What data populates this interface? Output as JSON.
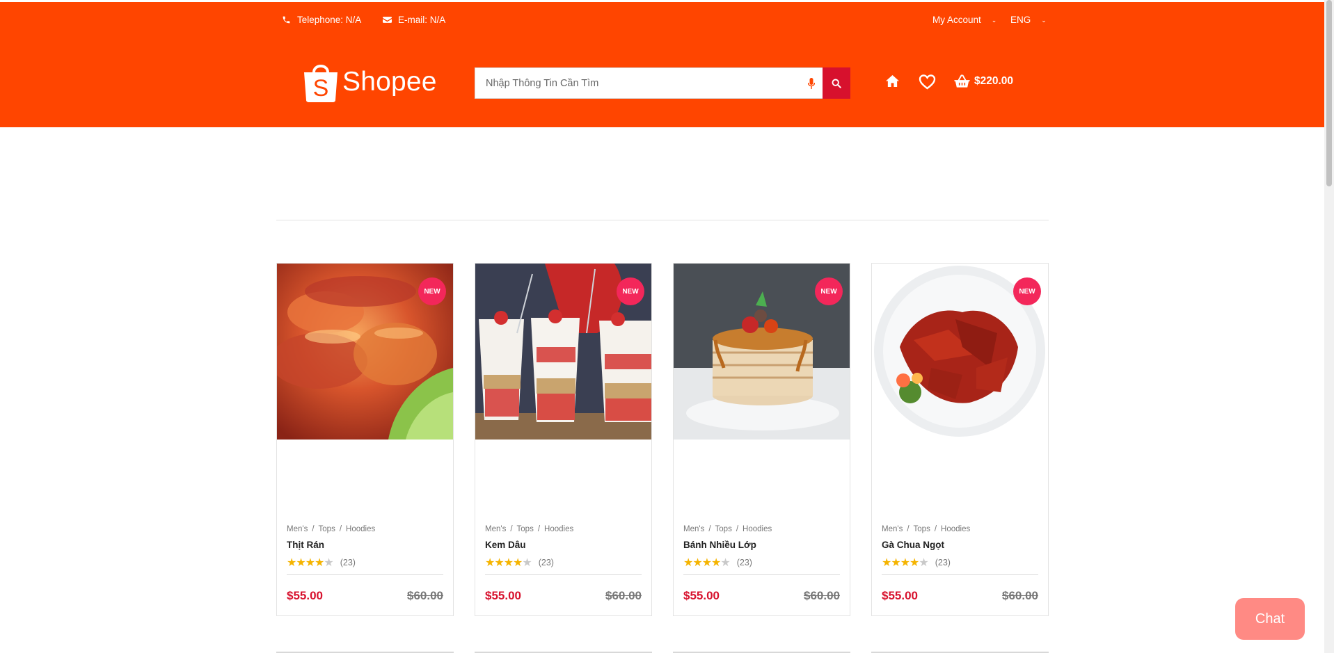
{
  "topbar": {
    "telephone": "Telephone: N/A",
    "email": "E-mail: N/A",
    "account": "My Account",
    "language": "ENG"
  },
  "logo": {
    "text": "Shopee",
    "icon": "shopping-bag-icon"
  },
  "search": {
    "placeholder": "Nhập Thông Tin Cần Tìm",
    "value": ""
  },
  "header_actions": {
    "cart_total": "$220.00"
  },
  "products": [
    {
      "badge": "NEW",
      "crumbs": [
        "Men's",
        "Tops",
        "Hoodies"
      ],
      "name": "Thịt Rán",
      "rating": 4.5,
      "reviews": "(23)",
      "price": "$55.00",
      "old_price": "$60.00"
    },
    {
      "badge": "NEW",
      "crumbs": [
        "Men's",
        "Tops",
        "Hoodies"
      ],
      "name": "Kem Dâu",
      "rating": 4.5,
      "reviews": "(23)",
      "price": "$55.00",
      "old_price": "$60.00"
    },
    {
      "badge": "NEW",
      "crumbs": [
        "Men's",
        "Tops",
        "Hoodies"
      ],
      "name": "Bánh Nhiều Lớp",
      "rating": 4.5,
      "reviews": "(23)",
      "price": "$55.00",
      "old_price": "$60.00"
    },
    {
      "badge": "NEW",
      "crumbs": [
        "Men's",
        "Tops",
        "Hoodies"
      ],
      "name": "Gà Chua Ngọt",
      "rating": 4.5,
      "reviews": "(23)",
      "price": "$55.00",
      "old_price": "$60.00"
    }
  ],
  "chat": {
    "label": "Chat"
  },
  "colors": {
    "header": "#ff4500",
    "accent": "#d7112d",
    "badge": "#f3275a",
    "chat": "#ff8a84"
  }
}
